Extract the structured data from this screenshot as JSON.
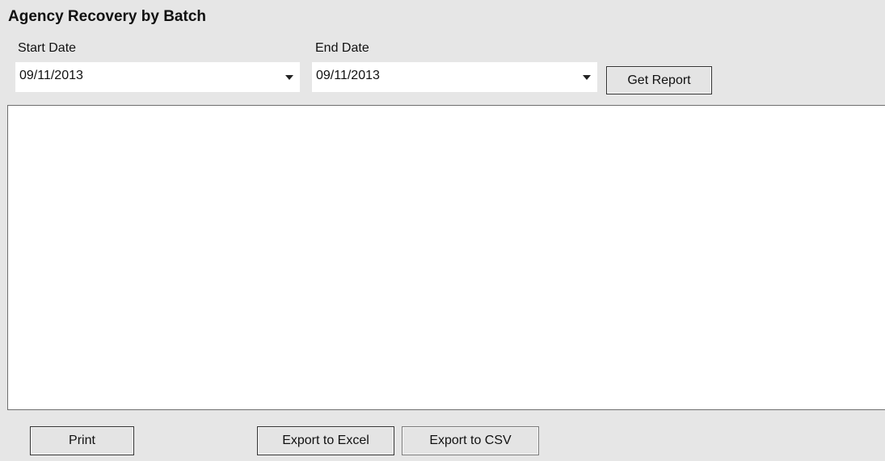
{
  "title": "Agency Recovery by Batch",
  "start_date": {
    "label": "Start Date",
    "value": "09/11/2013",
    "icon": "chevron-down-icon"
  },
  "end_date": {
    "label": "End Date",
    "value": "09/11/2013",
    "icon": "chevron-down-icon"
  },
  "buttons": {
    "get_report": "Get Report",
    "print": "Print",
    "export_excel": "Export to Excel",
    "export_csv": "Export to CSV"
  },
  "colors": {
    "background": "#e6e6e6",
    "report_area": "#ffffff"
  }
}
